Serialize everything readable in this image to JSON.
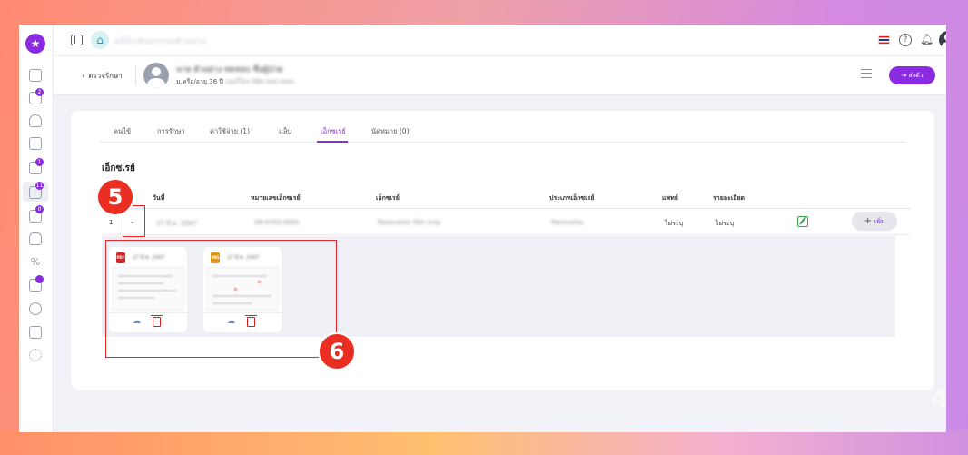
{
  "sidebar": {
    "badges": [
      "2",
      "1",
      "11",
      "0"
    ]
  },
  "topbar": {
    "clinic_name": "คลินิกทันตกรรมตัวอย่าง"
  },
  "patient": {
    "back_label": "ตรวจรักษา",
    "name": "นาย ตัวอย่าง ทดสอบ ชื่อผู้ป่วย",
    "sub_prefix": "ม.หรือ/อายุ 36 ปี",
    "sub_detail": "เบอร์โทร 08x-xxx-xxxx",
    "send_label": "ส่งตัว"
  },
  "tabs": [
    "คนไข้",
    "การรักษา",
    "ค่าใช้จ่าย (1)",
    "แล็บ",
    "เอ็กซเรย์",
    "นัดหมาย (0)"
  ],
  "section_title": "เอ็กซเรย์",
  "table": {
    "headers": [
      "วันที่",
      "หมายเลขเอ็กซเรย์",
      "เอ็กซเรย์",
      "ประเภทเอ็กซเรย์",
      "แพทย์",
      "รายละเอียด"
    ],
    "row": {
      "index": "1",
      "date": "27 มี.ค. 2567",
      "xray_no": "XR-0703-0001",
      "xray_name": "Panoramic film xray",
      "type": "Panorama",
      "doctor": "ไม่ระบุ",
      "detail": "ไม่ระบุ"
    },
    "add_label": "เพิ่ม"
  },
  "files": [
    {
      "badge": "PDF",
      "name": "27 มี.ค. 2567",
      "color": "#d0262a"
    },
    {
      "badge": "IMG",
      "name": "27 มี.ค. 2567",
      "color": "#e0951a"
    }
  ],
  "annotations": {
    "five": "5",
    "six": "6"
  },
  "colors": {
    "accent": "#8a2be2",
    "annotation": "#ea2e22"
  }
}
